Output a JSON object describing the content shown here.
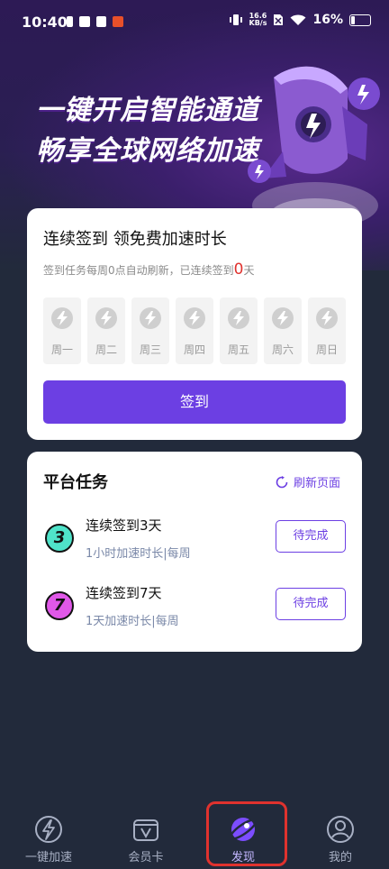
{
  "status_bar": {
    "time": "10:40",
    "net_speed_value": "16.6",
    "net_speed_unit": "KB/s",
    "battery": "16%"
  },
  "hero": {
    "line1": "一键开启智能通道",
    "line2": "畅享全球网络加速"
  },
  "checkin": {
    "title": "连续签到 领免费加速时长",
    "subtitle_prefix": "签到任务每周0点自动刷新，已连续签到",
    "streak_count": "0",
    "subtitle_suffix": "天",
    "days": [
      "周一",
      "周二",
      "周三",
      "周四",
      "周五",
      "周六",
      "周日"
    ],
    "button_label": "签到"
  },
  "tasks": {
    "title": "平台任务",
    "refresh_label": "刷新页面",
    "items": [
      {
        "badge": "3",
        "name": "连续签到3天",
        "desc": "1小时加速时长|每周",
        "button": "待完成"
      },
      {
        "badge": "7",
        "name": "连续签到7天",
        "desc": "1天加速时长|每周",
        "button": "待完成"
      }
    ]
  },
  "tab_bar": {
    "items": [
      {
        "label": "一键加速",
        "icon": "lightning-icon"
      },
      {
        "label": "会员卡",
        "icon": "vip-card-icon"
      },
      {
        "label": "发现",
        "icon": "discover-planet-icon"
      },
      {
        "label": "我的",
        "icon": "user-icon"
      }
    ],
    "active_index": 2
  },
  "colors": {
    "accent": "#6c3fe3",
    "background": "#222a3b",
    "streak": "#e0322e",
    "highlight": "#e0322e"
  }
}
